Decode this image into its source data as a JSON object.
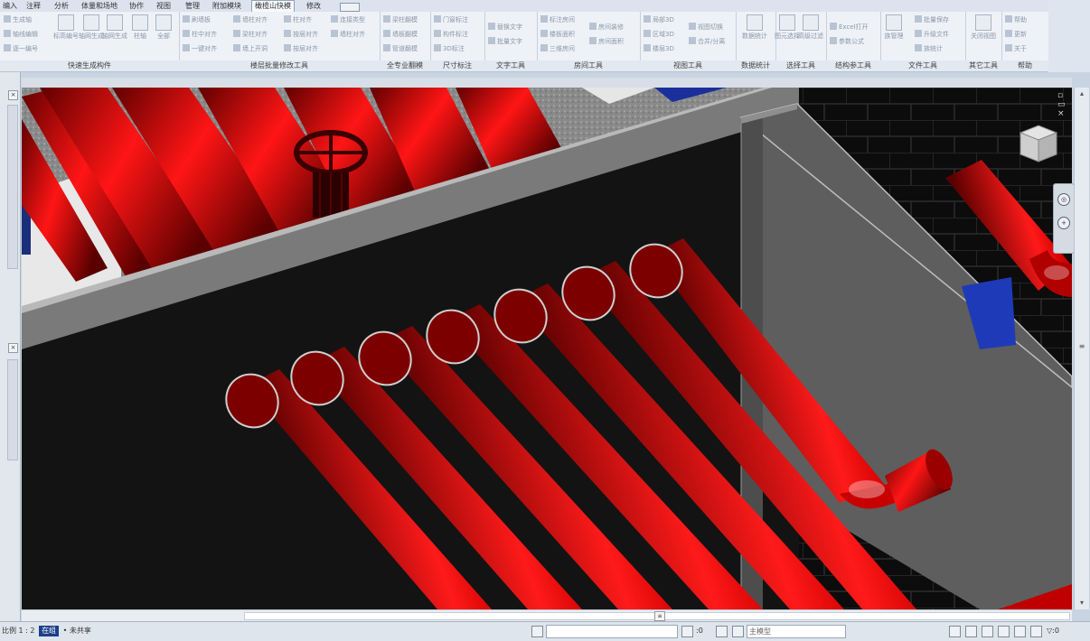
{
  "ribbon": {
    "tabs": [
      {
        "label": "编入",
        "active": false
      },
      {
        "label": "注释",
        "active": false
      },
      {
        "label": "分析",
        "active": false
      },
      {
        "label": "体量和场地",
        "active": false
      },
      {
        "label": "协作",
        "active": false
      },
      {
        "label": "视图",
        "active": false
      },
      {
        "label": "管理",
        "active": false
      },
      {
        "label": "附加模块",
        "active": false
      },
      {
        "label": "橄榄山快模",
        "active": true
      },
      {
        "label": "修改",
        "active": false
      }
    ],
    "panels": [
      {
        "label": "快速生成构件",
        "items": [
          "生成轴",
          "轴线编辑",
          "逐一编号",
          "标高编号",
          "轴网生成",
          "轴网生成",
          "柱轴",
          "轴线生成",
          "全部"
        ]
      },
      {
        "label": "楼层批量修改工具",
        "items": [
          "刷墙板",
          "柱中对齐",
          "一键对齐",
          "墙柱对齐",
          "梁柱对齐",
          "墙柱对齐",
          "墙上开洞",
          "柱对齐",
          "按层对齐",
          "按层对齐",
          "连接类型"
        ]
      },
      {
        "label": "全专业翻模",
        "items": [
          "梁柱翻模",
          "墙板翻模",
          "管道翻模"
        ]
      },
      {
        "label": "尺寸标注",
        "items": [
          "门窗标注",
          "构件标注",
          "3D标注"
        ]
      },
      {
        "label": "文字工具",
        "items": [
          "替换文字",
          "批量文字"
        ]
      },
      {
        "label": "房间工具",
        "items": [
          "标注房间",
          "楼板面积",
          "三维房间",
          "房间装修",
          "房间面积"
        ]
      },
      {
        "label": "视图工具",
        "items": [
          "局部3D",
          "区域3D",
          "楼层3D",
          "视图切换",
          "合并/分离"
        ]
      },
      {
        "label": "数据统计",
        "items": [
          "数据统计"
        ]
      },
      {
        "label": "选择工具",
        "items": [
          "图元选择",
          "高级过滤"
        ]
      },
      {
        "label": "结构参工具",
        "items": [
          "Excel打开",
          "参数公式"
        ]
      },
      {
        "label": "文件工具",
        "items": [
          "族管理",
          "批量保存",
          "升级文件",
          "族统计"
        ]
      },
      {
        "label": "其它工具",
        "items": [
          "关闭视图"
        ]
      },
      {
        "label": "帮助",
        "items": [
          "帮助",
          "更新",
          "关于"
        ]
      }
    ]
  },
  "status_bar": {
    "prompt_prefix": "比例",
    "prompt_value": "1 : 2",
    "workset_tag": "在组",
    "workset_text": "• 未共享",
    "main_model_field": "",
    "selection_count": ":0",
    "design_option": "主模型"
  },
  "viewport": {
    "controls": [
      "minimize",
      "restore",
      "close"
    ]
  }
}
